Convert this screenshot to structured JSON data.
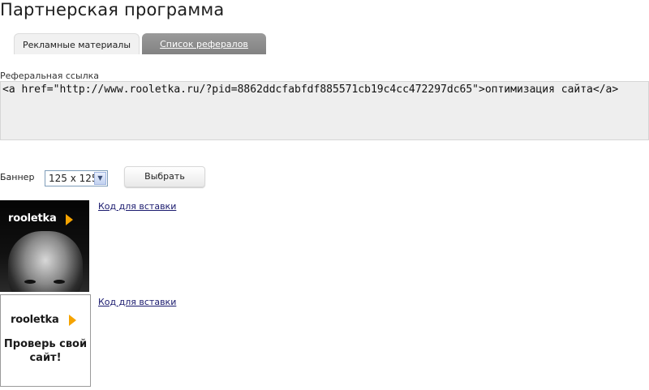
{
  "page": {
    "title": "Партнерская программа"
  },
  "tabs": [
    {
      "label": "Рекламные материалы",
      "active": true
    },
    {
      "label": "Список рефералов",
      "active": false
    }
  ],
  "referral": {
    "label": "Реферальная ссылка",
    "code": "<a href=\"http://www.rooletka.ru/?pid=8862ddcfabfdf885571cb19c4cc472297dc65\">оптимизация сайта</a>"
  },
  "banner_select": {
    "label": "Баннер",
    "selected": "125 x 125",
    "button_label": "Выбрать"
  },
  "banners": [
    {
      "logo": "rooletka",
      "slogan": "",
      "link_label": "Код для вставки"
    },
    {
      "logo": "rooletka",
      "slogan": "Проверь свой сайт!",
      "link_label": "Код для вставки"
    }
  ],
  "colors": {
    "brand_arrow": "#f5a300",
    "tab_inactive": "#8c8c8c",
    "ref_box_bg": "#eeeeee"
  }
}
